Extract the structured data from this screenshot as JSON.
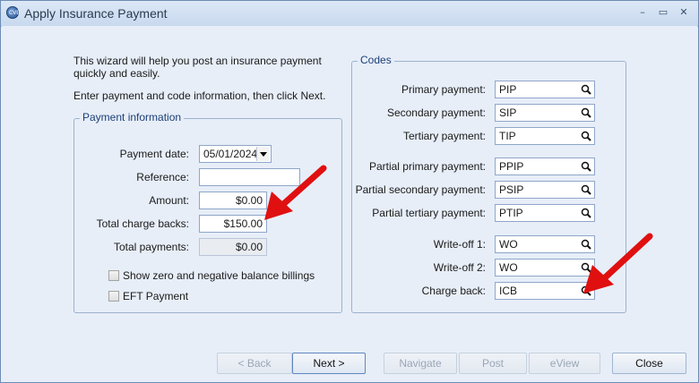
{
  "window": {
    "title": "Apply Insurance Payment",
    "app_icon_text": "CVE",
    "minimize": "–",
    "maximize": "▭",
    "close": "✕"
  },
  "intro": {
    "line1": "This wizard will help you post an insurance payment quickly and easily.",
    "line2": "Enter payment and code information, then click Next."
  },
  "payment_info": {
    "title": "Payment information",
    "payment_date_label": "Payment date:",
    "payment_date_value": "05/01/2024",
    "reference_label": "Reference:",
    "reference_value": "",
    "amount_label": "Amount:",
    "amount_value": "$0.00",
    "charge_backs_label": "Total charge backs:",
    "charge_backs_value": "$150.00",
    "total_payments_label": "Total payments:",
    "total_payments_value": "$0.00",
    "show_zero_label": "Show zero and negative balance billings",
    "eft_label": "EFT Payment"
  },
  "codes": {
    "title": "Codes",
    "primary_label": "Primary payment:",
    "primary_value": "PIP",
    "secondary_label": "Secondary payment:",
    "secondary_value": "SIP",
    "tertiary_label": "Tertiary payment:",
    "tertiary_value": "TIP",
    "partial_primary_label": "Partial primary payment:",
    "partial_primary_value": "PPIP",
    "partial_secondary_label": "Partial secondary payment:",
    "partial_secondary_value": "PSIP",
    "partial_tertiary_label": "Partial tertiary payment:",
    "partial_tertiary_value": "PTIP",
    "writeoff1_label": "Write-off 1:",
    "writeoff1_value": "WO",
    "writeoff2_label": "Write-off 2:",
    "writeoff2_value": "WO",
    "chargeback_label": "Charge back:",
    "chargeback_value": "ICB"
  },
  "buttons": {
    "back": "< Back",
    "next": "Next >",
    "navigate": "Navigate",
    "post": "Post",
    "eview": "eView",
    "close": "Close"
  },
  "colors": {
    "annotation_arrow": "#e01010",
    "accent": "#1c3f77"
  }
}
